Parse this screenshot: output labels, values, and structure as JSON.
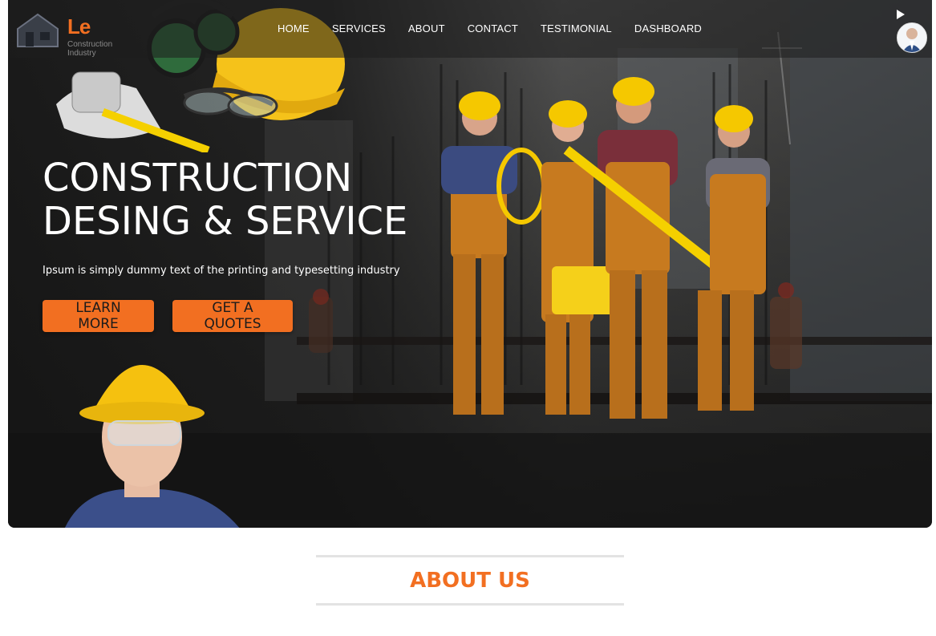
{
  "brand": {
    "logo_text": "Le",
    "logo_subtitle": "Construction Industry",
    "accent_color": "#f26f21"
  },
  "nav": {
    "items": [
      "HOME",
      "SERVICES",
      "ABOUT",
      "CONTACT",
      "TESTIMONIAL",
      "DASHBOARD"
    ]
  },
  "header_icons": {
    "play": "play-icon",
    "avatar": "user-avatar"
  },
  "hero": {
    "title_line1": "CONSTRUCTION",
    "title_line2": "DESING & SERVICE",
    "subtitle": "Ipsum is simply dummy text of the printing and typesetting industry",
    "learn_more": "LEARN MORE",
    "get_quotes": "GET A QUOTES"
  },
  "about": {
    "heading": "ABOUT US"
  }
}
